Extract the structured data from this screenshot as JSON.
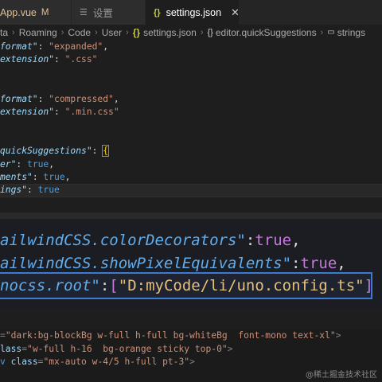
{
  "tabs": [
    {
      "label": "App.vue",
      "modified": "M",
      "icon": "vue-icon"
    },
    {
      "label": "设置",
      "icon": "settings-list-icon"
    },
    {
      "label": "settings.json",
      "icon": "json-braces-icon",
      "close": "✕"
    }
  ],
  "breadcrumb": {
    "items": [
      "ta",
      "Roaming",
      "Code",
      "User",
      "settings.json",
      "editor.quickSuggestions",
      "strings"
    ]
  },
  "code": {
    "l1": {
      "key": "format\"",
      "val": "\"expanded\""
    },
    "l2": {
      "key": "extension\"",
      "val": "\".css\""
    },
    "l3": {
      "key": "format\"",
      "val": "\"compressed\""
    },
    "l4": {
      "key": "extension\"",
      "val": "\".min.css\""
    },
    "l5": {
      "key": "quickSuggestions\"",
      "brace": "{"
    },
    "l6": {
      "key": "er\"",
      "val": "true"
    },
    "l7": {
      "key": "ments\"",
      "val": "true"
    },
    "l8": {
      "key": "ings\"",
      "val": "true"
    }
  },
  "zoom": {
    "z1": {
      "key": "ailwindCSS.colorDecorators\"",
      "val": "true"
    },
    "z2": {
      "key": "ailwindCSS.showPixelEquivalents\"",
      "val": "true"
    },
    "z3": {
      "key": "nocss.root\"",
      "val": "\"D:myCode/li/uno.config.ts\""
    }
  },
  "html": {
    "h1": {
      "val": "\"dark:bg-blockBg w-full h-full bg-whiteBg  font-mono text-xl\""
    },
    "h2": {
      "attr": "lass",
      "val": "\"w-full h-16  bg-orange sticky top-0\""
    },
    "h3": {
      "tag": "v",
      "attr": "class",
      "val": "\"mx-auto w-4/5 h-full pt-3\""
    }
  },
  "watermark": "@稀土掘金技术社区"
}
